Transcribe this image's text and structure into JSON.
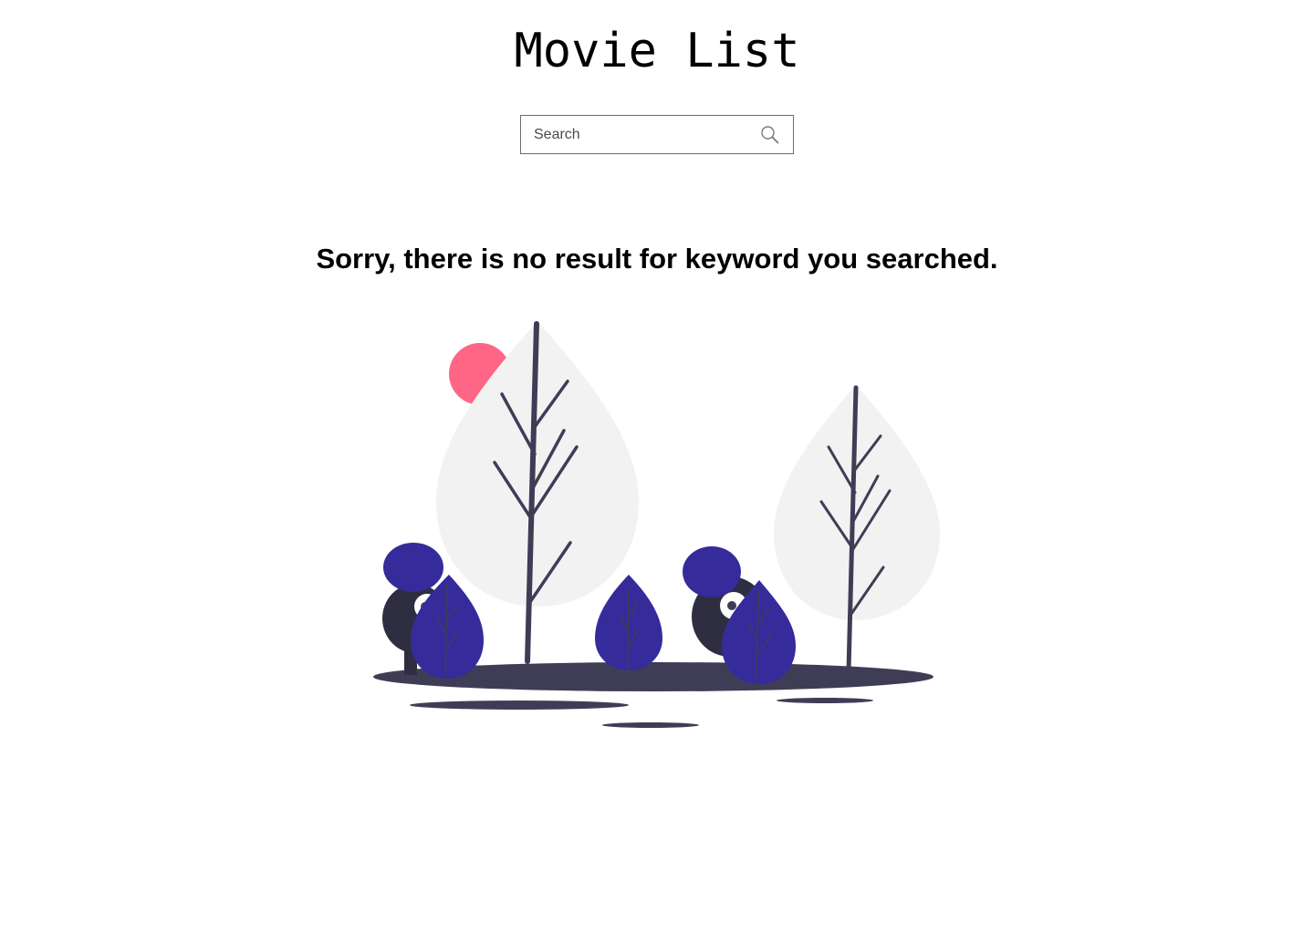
{
  "header": {
    "title": "Movie List"
  },
  "search": {
    "placeholder": "Search",
    "value": "",
    "icon": "search-icon"
  },
  "results": {
    "empty_message": "Sorry, there is no result for keyword you searched."
  },
  "illustration": {
    "name": "no-results-illustration",
    "colors": {
      "sun": "#ff6584",
      "leaf_light": "#f2f2f2",
      "leaf_accent": "#352b9b",
      "trunk": "#3f3d56",
      "creature": "#2f2e41"
    }
  }
}
